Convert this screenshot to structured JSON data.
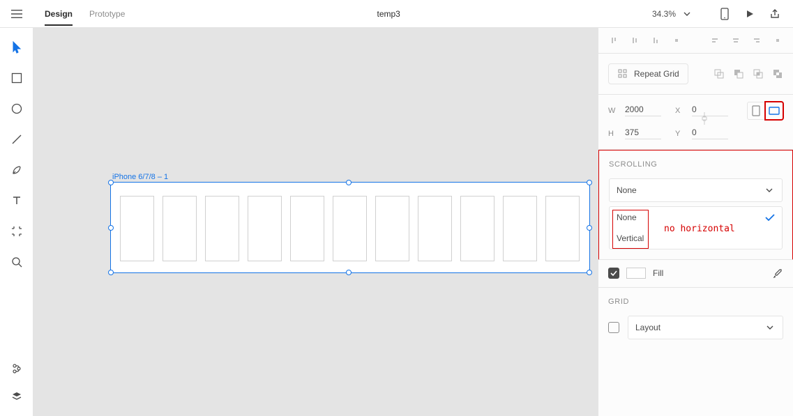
{
  "header": {
    "tabs": {
      "design": "Design",
      "prototype": "Prototype"
    },
    "document_title": "temp3",
    "zoom": "34.3%"
  },
  "canvas": {
    "artboard_label": "iPhone 6/7/8 – 1"
  },
  "inspector": {
    "repeat_grid_label": "Repeat Grid",
    "dimensions": {
      "w_label": "W",
      "w": "2000",
      "h_label": "H",
      "h": "375",
      "x_label": "X",
      "x": "0",
      "y_label": "Y",
      "y": "0"
    },
    "scrolling": {
      "title": "SCROLLING",
      "selected": "None",
      "options": {
        "none": "None",
        "vertical": "Vertical"
      },
      "annotation": "no horizontal"
    },
    "fill": {
      "label": "Fill"
    },
    "grid": {
      "title": "GRID",
      "value": "Layout"
    }
  }
}
